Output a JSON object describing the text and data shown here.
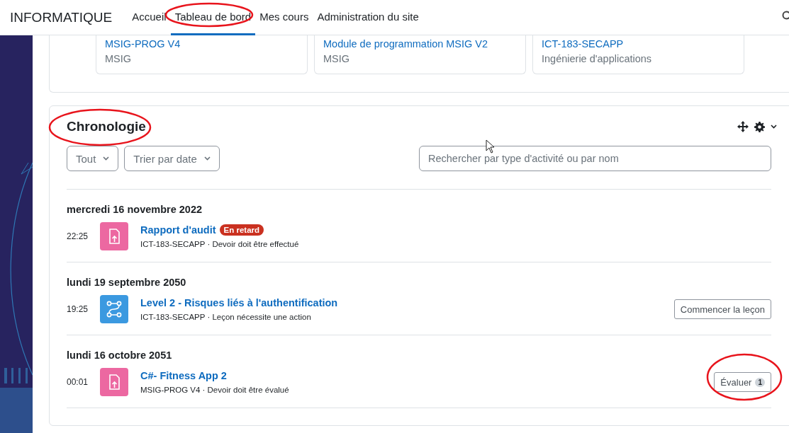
{
  "navbar": {
    "site_name": "INFORMATIQUE",
    "items": [
      {
        "label": "Accueil",
        "selected": false
      },
      {
        "label": "Tableau de bord",
        "selected": true
      },
      {
        "label": "Mes cours",
        "selected": false
      },
      {
        "label": "Administration du site",
        "selected": false
      }
    ]
  },
  "courses": [
    {
      "name": "MSIG-PROG V4",
      "category": "MSIG"
    },
    {
      "name": "Module de programmation MSIG V2",
      "category": "MSIG"
    },
    {
      "name": "ICT-183-SECAPP",
      "category": "Ingénierie d'applications"
    }
  ],
  "timeline": {
    "title": "Chronologie",
    "filters": [
      "Tout",
      "Trier par date"
    ],
    "search": {
      "placeholder": "Rechercher par type d'activité ou par nom"
    },
    "days": [
      {
        "date": "mercredi 16 novembre 2022",
        "events": [
          {
            "kind": "assignment",
            "time": "22:25",
            "title": "Rapport d'audit",
            "badge": "En retard",
            "meta": "ICT-183-SECAPP · Devoir doit être effectué"
          }
        ]
      },
      {
        "date": "lundi 19 septembre 2050",
        "events": [
          {
            "kind": "lesson",
            "time": "19:25",
            "title": "Level 2 - Risques liés à l'authentification",
            "meta": "ICT-183-SECAPP · Leçon nécessite une action",
            "action": {
              "label": "Commencer la leçon"
            }
          }
        ]
      },
      {
        "date": "lundi 16 octobre 2051",
        "events": [
          {
            "kind": "assignment",
            "time": "00:01",
            "title": "C#- Fitness App 2",
            "meta": "MSIG-PROG V4 · Devoir doit être évalué",
            "action": {
              "label": "Évaluer",
              "count": "1"
            }
          }
        ]
      }
    ]
  }
}
